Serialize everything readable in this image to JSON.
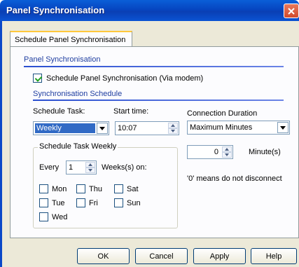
{
  "window": {
    "title": "Panel Synchronisation"
  },
  "tabs": [
    {
      "label": "Schedule Panel Synchronisation"
    }
  ],
  "panel_sync": {
    "section_title": "Panel Synchronisation",
    "checkbox_label": "Schedule Panel Synchronisation (Via modem)",
    "checked": true
  },
  "schedule": {
    "section_title": "Synchronisation Schedule",
    "task_label": "Schedule Task:",
    "task_value": "Weekly",
    "start_label": "Start time:",
    "start_value": "10:07",
    "duration_label": "Connection Duration",
    "duration_value": "Maximum  Minutes",
    "minutes_value": "0",
    "minutes_label": "Minute(s)",
    "note": "'0' means do not disconnect"
  },
  "weekly": {
    "group_title": "Schedule Task Weekly",
    "every_label": "Every",
    "every_value": "1",
    "weeks_label": "Weeks(s) on:",
    "days": [
      "Mon",
      "Thu",
      "Sat",
      "Tue",
      "Fri",
      "Sun",
      "Wed"
    ]
  },
  "buttons": {
    "ok": "OK",
    "cancel": "Cancel",
    "apply": "Apply",
    "help": "Help"
  },
  "colors": {
    "title_bar": "#0a4fd0",
    "section_text": "#1f3ea0",
    "dialog_bg": "#ece9d8"
  }
}
